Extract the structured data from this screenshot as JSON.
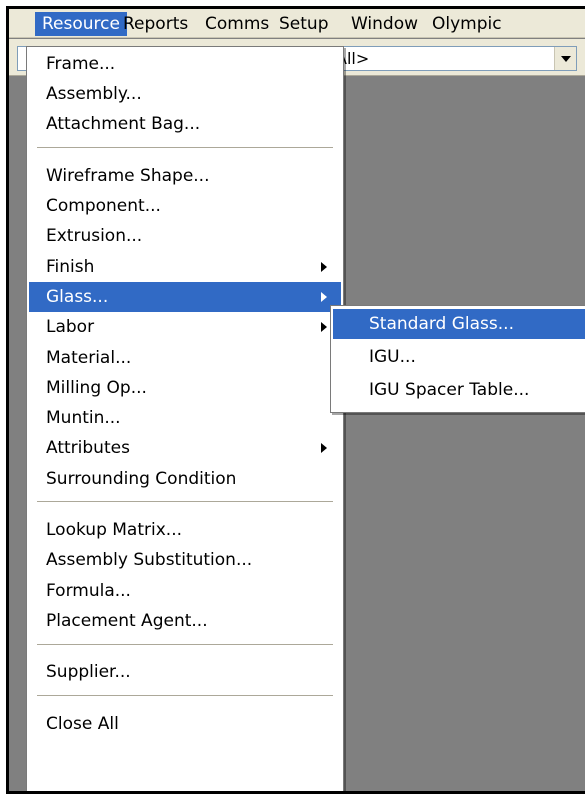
{
  "menubar": {
    "items": [
      {
        "label": "Resource",
        "active": true
      },
      {
        "label": "Reports"
      },
      {
        "label": "Comms"
      },
      {
        "label": "Setup"
      },
      {
        "label": "Window"
      },
      {
        "label": "Olympic"
      }
    ]
  },
  "toolbar": {
    "filter_combo": {
      "value": "All>"
    }
  },
  "resource_menu": {
    "items": [
      {
        "label": "Frame..."
      },
      {
        "label": "Assembly..."
      },
      {
        "label": "Attachment Bag..."
      },
      {
        "label": "Wireframe Shape..."
      },
      {
        "label": "Component..."
      },
      {
        "label": "Extrusion..."
      },
      {
        "label": "Finish",
        "submenu": true
      },
      {
        "label": "Glass...",
        "submenu": true,
        "highlighted": true
      },
      {
        "label": "Labor",
        "submenu": true
      },
      {
        "label": "Material..."
      },
      {
        "label": "Milling Op..."
      },
      {
        "label": "Muntin..."
      },
      {
        "label": "Attributes",
        "submenu": true
      },
      {
        "label": "Surrounding Condition"
      },
      {
        "label": "Lookup Matrix..."
      },
      {
        "label": "Assembly Substitution..."
      },
      {
        "label": "Formula..."
      },
      {
        "label": "Placement Agent..."
      },
      {
        "label": "Supplier..."
      },
      {
        "label": "Close All"
      }
    ]
  },
  "glass_submenu": {
    "items": [
      {
        "label": "Standard Glass...",
        "highlighted": true
      },
      {
        "label": "IGU..."
      },
      {
        "label": "IGU Spacer Table..."
      }
    ]
  },
  "icons": {
    "submenu_arrow": "chevron-right-icon",
    "dropdown_arrow": "chevron-down-icon"
  },
  "colors": {
    "highlight": "#316ac5",
    "menubar_bg": "#ece9d8",
    "workspace_bg": "#808080"
  }
}
